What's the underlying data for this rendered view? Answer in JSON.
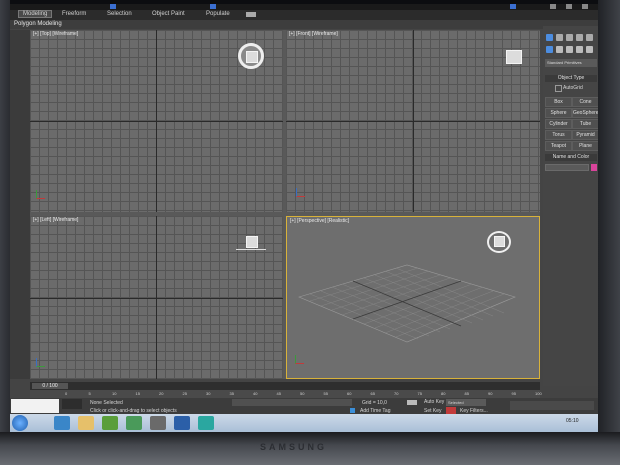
{
  "ribbon": {
    "tabs": [
      "Modeling",
      "Freeform",
      "Selection",
      "Object Paint",
      "Populate"
    ],
    "subtitle": "Polygon Modeling"
  },
  "viewports": {
    "top": "[+] [Top] [Wireframe]",
    "front": "[+] [Front] [Wireframe]",
    "left": "[+] [Left] [Wireframe]",
    "perspective": "[+] [Perspective] [Realistic]"
  },
  "command_panel": {
    "dropdown": "Standard Primitives",
    "object_type_header": "Object Type",
    "autogrid_label": "AutoGrid",
    "buttons": [
      "Box",
      "Cone",
      "Sphere",
      "GeoSphere",
      "Cylinder",
      "Tube",
      "Torus",
      "Pyramid",
      "Teapot",
      "Plane"
    ],
    "name_color_header": "Name and Color",
    "name_color_swatch": "#d9449b"
  },
  "timeline": {
    "frame_counter": "0 / 100",
    "tick_labels": [
      "0",
      "5",
      "10",
      "15",
      "20",
      "25",
      "30",
      "35",
      "40",
      "45",
      "50",
      "55",
      "60",
      "65",
      "70",
      "75",
      "80",
      "85",
      "90",
      "95",
      "100"
    ]
  },
  "status": {
    "selection": "None Selected",
    "prompt": "Click or click-and-drag to select objects",
    "grid": "Grid = 10,0",
    "add_time_tag": "Add Time Tag",
    "auto_key": "Auto Key",
    "selected": "Selected",
    "set_key": "Set Key",
    "key_filters": "Key Filters..."
  },
  "taskbar": {
    "clock": "05:10"
  },
  "bezel": {
    "brand": "SAMSUNG"
  },
  "colors": {
    "active_viewport_border": "#d8b23a",
    "ribbon_active": "#4a4a4a"
  }
}
